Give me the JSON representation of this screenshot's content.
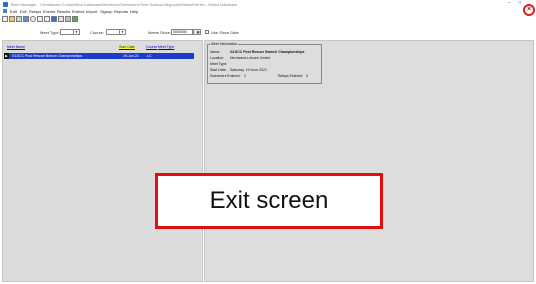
{
  "window": {
    "title": "Team Manager - Centralized Competition Database/Members/Swimmers/Time Swims/Lifeguard/Meets/Entries - Mixed Database",
    "min_glyph": "–",
    "max_glyph": "□",
    "close_glyph": "×"
  },
  "menu": [
    "Edit",
    "Exit",
    "Relays",
    "Events",
    "Results",
    "Entries",
    "Import",
    "Signup",
    "Reports",
    "Help"
  ],
  "filters": {
    "meet_type_label": "Meet Type:",
    "meet_type_value": "",
    "course_label": "Course:",
    "course_value": "",
    "meets_since_label": "Meets Since:",
    "meets_since_value": "00/00/00",
    "use_since_label": "Use Since Date"
  },
  "grid": {
    "columns": [
      "Meet Name",
      "Start Date",
      "Course",
      "Meet Type"
    ],
    "rows": [
      {
        "meet_name": "GLSCC Pool Rescue Branch Championships",
        "start_date": "19-Jun-21",
        "course": "LC",
        "meet_type": ""
      }
    ]
  },
  "meet_info": {
    "legend": "Meet Information",
    "fields": [
      {
        "label": "Name:",
        "value": "GLSCC Pool Rescue Branch Championships"
      },
      {
        "label": "Location:",
        "value": "Nerriwarra Leisure Centre"
      },
      {
        "label": "Meet Type:",
        "value": ""
      },
      {
        "label": "Start Date:",
        "value": "Saturday, 19 June 2021"
      }
    ],
    "swimmers_label": "Swimmers Entered:",
    "swimmers_value": "2",
    "relays_label": "Relays Entered:",
    "relays_value": "0"
  },
  "annotation": {
    "text": "Exit screen"
  },
  "colors": {
    "selection": "#1e3cc8",
    "highlight": "#ffff33",
    "annotation_border": "#e01010"
  }
}
